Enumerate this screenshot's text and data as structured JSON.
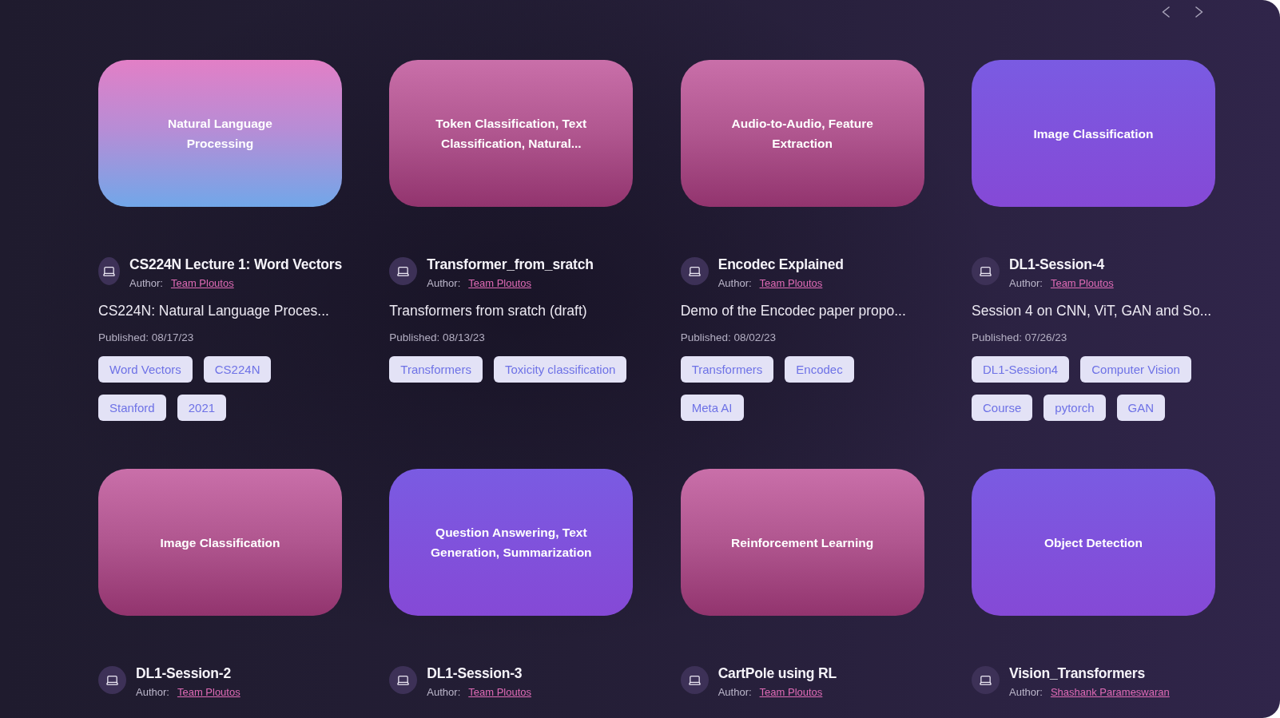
{
  "projects": [
    {
      "cover": {
        "kind": "pink-blue",
        "label": [
          "Natural Language",
          "Processing"
        ]
      },
      "title": "CS224N Lecture 1: Word Vectors",
      "author_label": "Author:",
      "author": "Team Ploutos",
      "description": "CS224N: Natural Language Proces...",
      "published": "Published: 08/17/23",
      "tags": [
        "Word Vectors",
        "CS224N",
        "Stanford",
        "2021"
      ]
    },
    {
      "cover": {
        "kind": "pink",
        "label": [
          "Token Classification, Text",
          "Classification, Natural..."
        ]
      },
      "title": "Transformer_from_sratch",
      "author_label": "Author:",
      "author": "Team Ploutos",
      "description": "Transformers from sratch (draft)",
      "published": "Published: 08/13/23",
      "tags": [
        "Transformers",
        "Toxicity classification"
      ]
    },
    {
      "cover": {
        "kind": "pink",
        "label": [
          "Audio-to-Audio, Feature",
          "Extraction"
        ]
      },
      "title": "Encodec Explained",
      "author_label": "Author:",
      "author": "Team Ploutos",
      "description": "Demo of the Encodec paper propo...",
      "published": "Published: 08/02/23",
      "tags": [
        "Transformers",
        "Encodec",
        "Meta AI"
      ]
    },
    {
      "cover": {
        "kind": "purple",
        "label": [
          "Image Classification"
        ]
      },
      "title": "DL1-Session-4",
      "author_label": "Author:",
      "author": "Team Ploutos",
      "description": "Session 4 on CNN, ViT, GAN and So...",
      "published": "Published: 07/26/23",
      "tags": [
        "DL1-Session4",
        "Computer Vision",
        "Course",
        "pytorch",
        "GAN"
      ]
    },
    {
      "cover": {
        "kind": "pink",
        "label": [
          "Image Classification"
        ]
      },
      "title": "DL1-Session-2",
      "author_label": "Author:",
      "author": "Team Ploutos"
    },
    {
      "cover": {
        "kind": "purple",
        "label": [
          "Question Answering, Text",
          "Generation, Summarization"
        ]
      },
      "title": "DL1-Session-3",
      "author_label": "Author:",
      "author": "Team Ploutos"
    },
    {
      "cover": {
        "kind": "pink",
        "label": [
          "Reinforcement Learning"
        ]
      },
      "title": "CartPole using RL",
      "author_label": "Author:",
      "author": "Team Ploutos"
    },
    {
      "cover": {
        "kind": "purple",
        "label": [
          "Object Detection"
        ]
      },
      "title": "Vision_Transformers",
      "author_label": "Author:",
      "author": "Shashank Parameswaran"
    }
  ]
}
